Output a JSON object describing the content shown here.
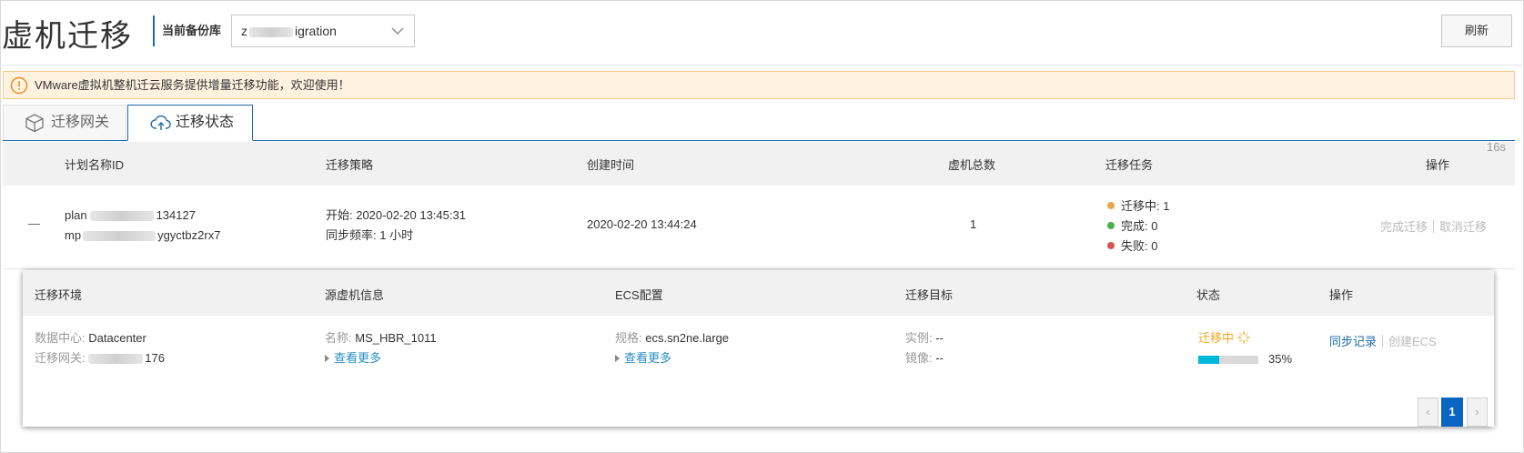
{
  "header": {
    "title": "虚机迁移",
    "repo_label": "当前备份库",
    "repo_value_prefix": "z",
    "repo_value_suffix": "igration",
    "refresh_label": "刷新"
  },
  "notice": {
    "text": "VMware虚拟机整机迁云服务提供增量迁移功能，欢迎使用！",
    "icon": "warning-circle-icon"
  },
  "tabs": [
    {
      "label": "迁移网关",
      "icon": "box-icon",
      "active": false
    },
    {
      "label": "迁移状态",
      "icon": "cloud-upload-icon",
      "active": true
    }
  ],
  "refresh_timer": "16s",
  "plan_table": {
    "columns": [
      "计划名称ID",
      "迁移策略",
      "创建时间",
      "虚机总数",
      "迁移任务",
      "操作"
    ],
    "row": {
      "collapse": "—",
      "name_prefix": "plan",
      "name_suffix": "134127",
      "id_prefix": "mp",
      "id_suffix": "ygyctbz2rx7",
      "strategy_start": "开始: 2020-02-20 13:45:31",
      "strategy_freq": "同步频率: 1 小时",
      "created": "2020-02-20 13:44:24",
      "vm_total": "1",
      "tasks": [
        {
          "label": "迁移中: 1",
          "color": "#e8a84a"
        },
        {
          "label": "完成: 0",
          "color": "#4caf50"
        },
        {
          "label": "失败: 0",
          "color": "#d9534f"
        }
      ],
      "actions": [
        "完成迁移",
        "取消迁移"
      ]
    }
  },
  "detail_table": {
    "columns": [
      "迁移环境",
      "源虚机信息",
      "ECS配置",
      "迁移目标",
      "状态",
      "操作"
    ],
    "row": {
      "env_dc_label": "数据中心:",
      "env_dc_value": "Datacenter",
      "env_gw_label": "迁移网关:",
      "env_gw_suffix": "176",
      "src_name_label": "名称:",
      "src_name_value": "MS_HBR_1011",
      "src_more": "查看更多",
      "ecs_spec_label": "规格:",
      "ecs_spec_value": "ecs.sn2ne.large",
      "ecs_more": "查看更多",
      "target_instance_label": "实例:",
      "target_instance_value": "--",
      "target_image_label": "镜像:",
      "target_image_value": "--",
      "status_text": "迁移中",
      "progress_pct": 35,
      "progress_label": "35%",
      "action_sync": "同步记录",
      "action_create": "创建ECS"
    }
  },
  "pagination": {
    "prev": "‹",
    "current": "1",
    "next": "›"
  },
  "colors": {
    "accent": "#1c6aa6",
    "notice_bg": "#fff3e0",
    "status_orange": "#f5a623",
    "progress": "#00b8d9",
    "pager_active": "#0a64c2"
  }
}
